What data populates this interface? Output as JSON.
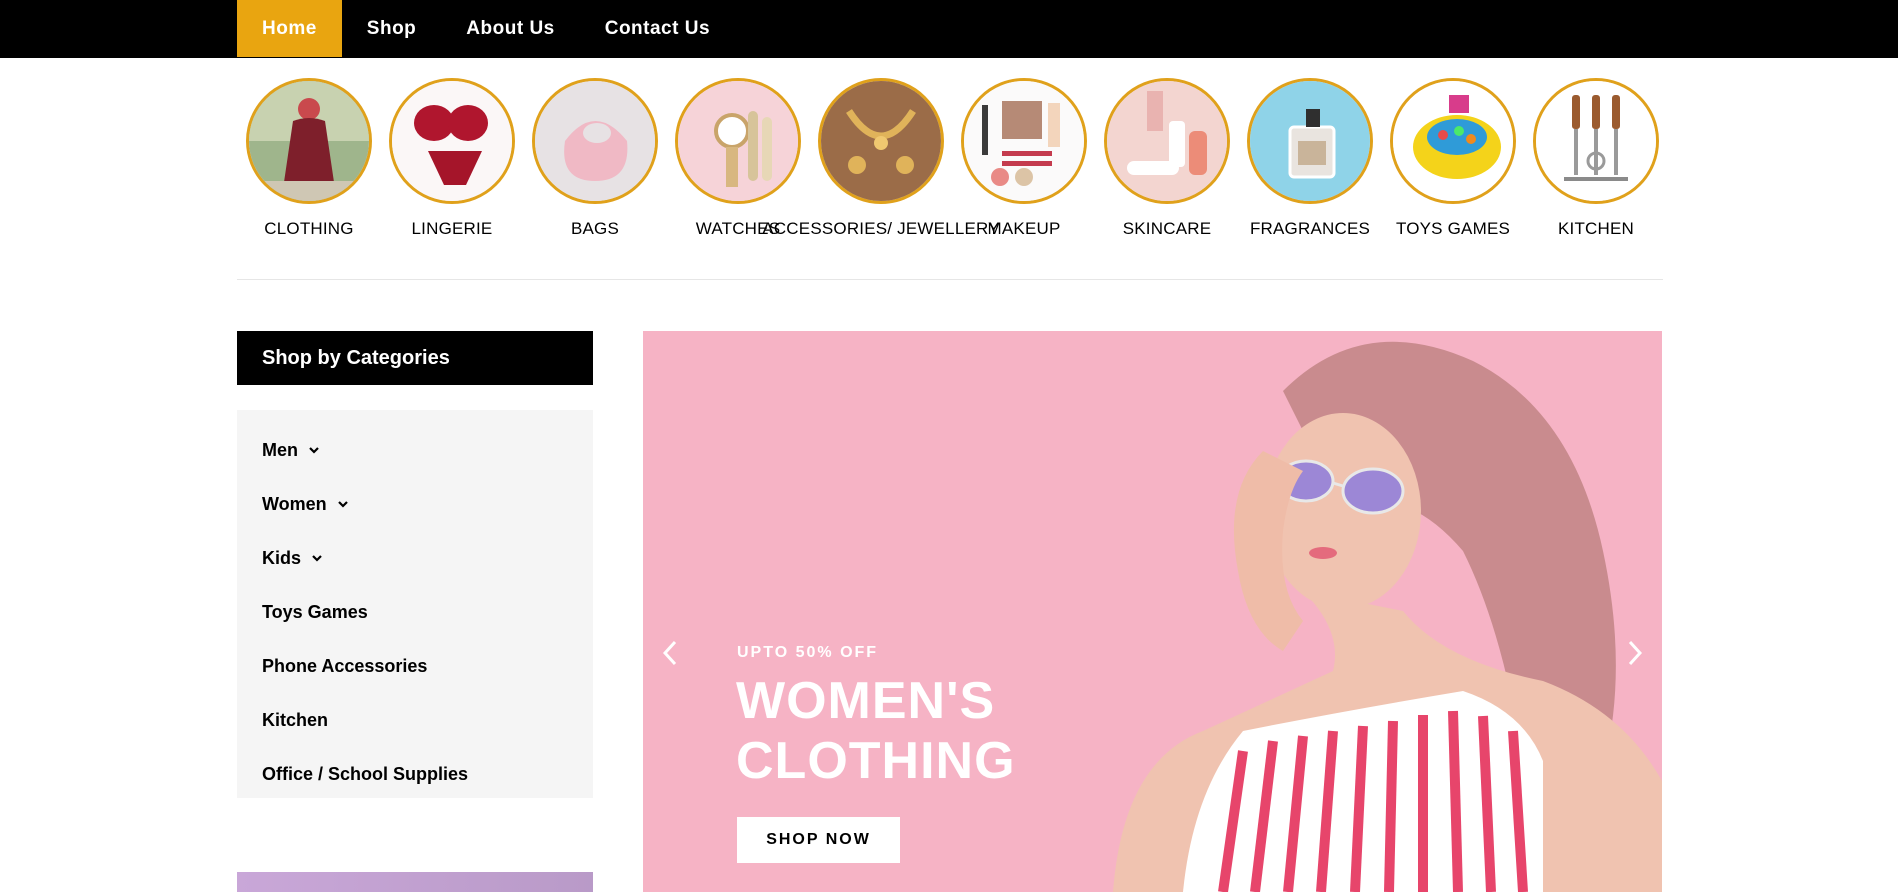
{
  "nav": {
    "items": [
      {
        "label": "Home",
        "active": true
      },
      {
        "label": "Shop",
        "active": false
      },
      {
        "label": "About Us",
        "active": false
      },
      {
        "label": "Contact Us",
        "active": false
      }
    ]
  },
  "categories": [
    {
      "label": "CLOTHING",
      "icon": "clothing-image"
    },
    {
      "label": "LINGERIE",
      "icon": "lingerie-image"
    },
    {
      "label": "BAGS",
      "icon": "bags-image"
    },
    {
      "label": "WATCHES",
      "icon": "watches-image"
    },
    {
      "label": "ACCESSORIES/ JEWELLERY",
      "icon": "jewellery-image"
    },
    {
      "label": "MAKEUP",
      "icon": "makeup-image"
    },
    {
      "label": "SKINCARE",
      "icon": "skincare-image"
    },
    {
      "label": "FRAGRANCES",
      "icon": "fragrance-image"
    },
    {
      "label": "TOYS GAMES",
      "icon": "toys-image"
    },
    {
      "label": "KITCHEN",
      "icon": "kitchen-image"
    }
  ],
  "sidebar": {
    "title": "Shop by Categories",
    "items": [
      {
        "label": "Men",
        "has_submenu": true
      },
      {
        "label": "Women",
        "has_submenu": true
      },
      {
        "label": "Kids",
        "has_submenu": true
      },
      {
        "label": "Toys Games",
        "has_submenu": false
      },
      {
        "label": "Phone Accessories",
        "has_submenu": false
      },
      {
        "label": "Kitchen",
        "has_submenu": false
      },
      {
        "label": "Office / School Supplies",
        "has_submenu": false
      }
    ]
  },
  "hero": {
    "eyebrow": "UPTO 50% OFF",
    "title": "WOMEN'S CLOTHING",
    "button": "SHOP NOW"
  },
  "colors": {
    "accent": "#e9a510",
    "nav_bg": "#000000",
    "circle_border": "#e0a11b",
    "hero_bg": "#f6b3c5",
    "sidebar_bg": "#f5f5f5"
  }
}
